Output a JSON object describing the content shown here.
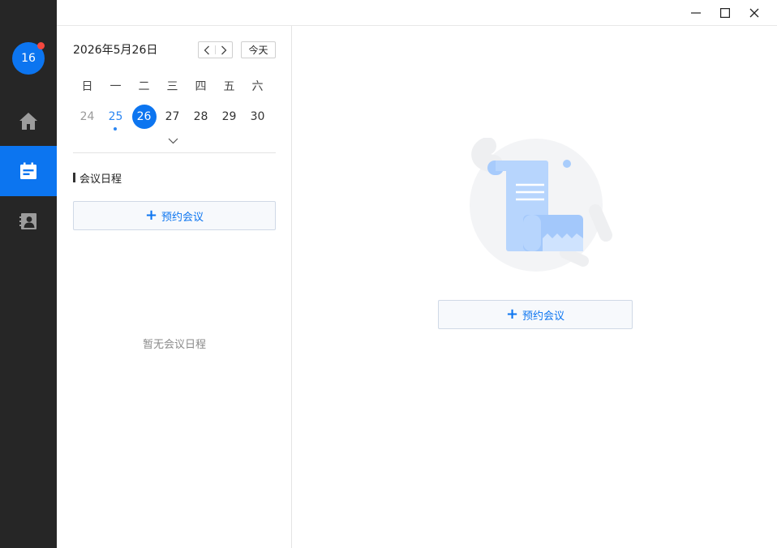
{
  "sidebar": {
    "avatar_text": "16",
    "items": [
      {
        "name": "home",
        "icon": "home-icon"
      },
      {
        "name": "meetings",
        "icon": "calendar-icon",
        "active": true
      },
      {
        "name": "contacts",
        "icon": "contacts-icon"
      }
    ]
  },
  "window": {
    "controls": [
      "minimize-icon",
      "maximize-icon",
      "close-icon"
    ]
  },
  "calendar": {
    "current_date": "2026年5月26日",
    "today_label": "今天",
    "weekdays": [
      "日",
      "一",
      "二",
      "三",
      "四",
      "五",
      "六"
    ],
    "days": [
      {
        "label": "24",
        "state": "past"
      },
      {
        "label": "25",
        "state": "has-event"
      },
      {
        "label": "26",
        "state": "selected"
      },
      {
        "label": "27",
        "state": "normal"
      },
      {
        "label": "28",
        "state": "normal"
      },
      {
        "label": "29",
        "state": "normal"
      },
      {
        "label": "30",
        "state": "normal"
      }
    ]
  },
  "schedule": {
    "section_title": "会议日程",
    "schedule_button": "预约会议",
    "empty_text": "暂无会议日程"
  },
  "main": {
    "schedule_button": "预约会议"
  },
  "colors": {
    "accent": "#0c75f0",
    "nav_bg": "#262626",
    "badge": "#f5483f"
  }
}
